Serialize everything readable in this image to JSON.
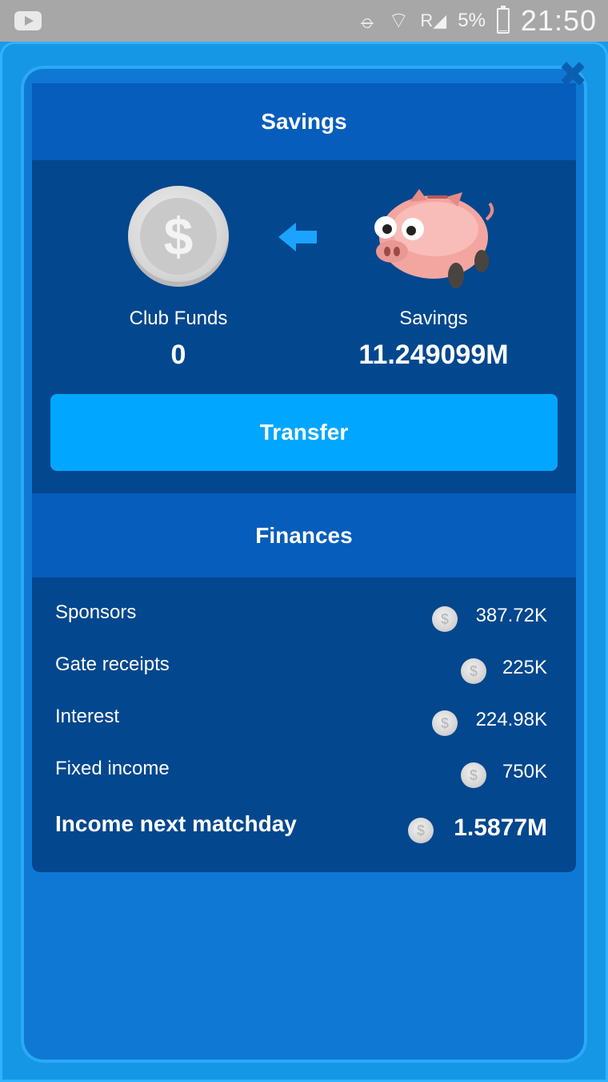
{
  "status_bar": {
    "time": "21:50",
    "battery_percent": "5%",
    "battery_level": 0.05,
    "signal_label": "R"
  },
  "savings": {
    "header": "Savings",
    "club_funds_label": "Club Funds",
    "club_funds_value": "0",
    "savings_label": "Savings",
    "savings_value": "11.249099M",
    "transfer_label": "Transfer"
  },
  "finances": {
    "header": "Finances",
    "rows": [
      {
        "label": "Sponsors",
        "value": "387.72K"
      },
      {
        "label": "Gate receipts",
        "value": "225K"
      },
      {
        "label": "Interest",
        "value": "224.98K"
      },
      {
        "label": "Fixed income",
        "value": "750K"
      }
    ],
    "total": {
      "label": "Income next matchday",
      "value": "1.5877M"
    }
  },
  "colors": {
    "accent": "#00a6ff",
    "panel_dark": "#03478e",
    "panel_header": "#065dbb"
  }
}
